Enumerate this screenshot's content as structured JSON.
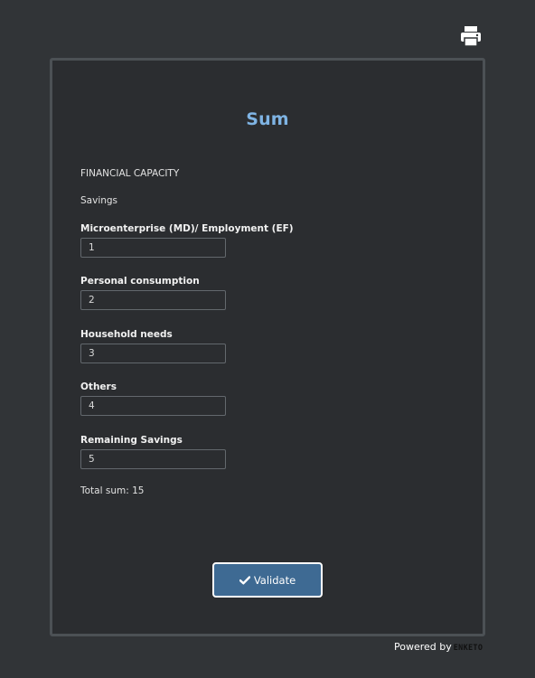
{
  "header": {
    "print_icon": "printer-icon"
  },
  "form": {
    "title": "Sum",
    "section_note": "FINANCIAL CAPACITY",
    "group_note": "Savings",
    "questions": [
      {
        "label": "Microenterprise (MD)/ Employment (EF)",
        "value": "1"
      },
      {
        "label": "Personal consumption",
        "value": "2"
      },
      {
        "label": "Household needs",
        "value": "3"
      },
      {
        "label": "Others",
        "value": "4"
      },
      {
        "label": "Remaining Savings",
        "value": "5"
      }
    ],
    "total_text": "Total sum: 15",
    "validate_label": "Validate",
    "validate_icon": "checkmark-icon"
  },
  "footer": {
    "powered_by": "Powered by",
    "brand": "ENKETO"
  }
}
